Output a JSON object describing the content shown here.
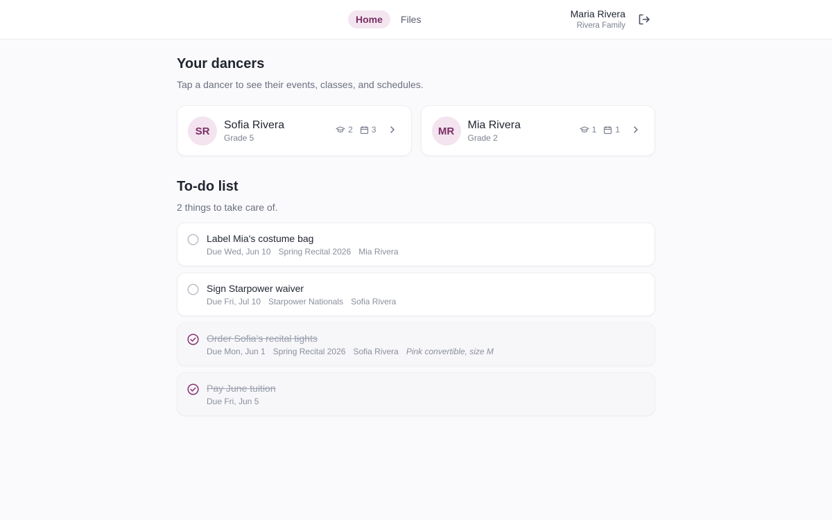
{
  "nav": {
    "items": [
      {
        "label": "Home",
        "active": true
      },
      {
        "label": "Files",
        "active": false
      }
    ]
  },
  "user": {
    "name": "Maria Rivera",
    "family": "Rivera Family",
    "logout_icon": "logout-icon"
  },
  "dancers_section": {
    "title": "Your dancers",
    "subtitle": "Tap a dancer to see their events, classes, and schedules.",
    "dancers": [
      {
        "initials": "SR",
        "name": "Sofia Rivera",
        "grade": "Grade 5",
        "classes": "2",
        "events": "3"
      },
      {
        "initials": "MR",
        "name": "Mia Rivera",
        "grade": "Grade 2",
        "classes": "1",
        "events": "1"
      }
    ]
  },
  "todo_section": {
    "title": "To-do list",
    "subtitle": "2 things to take care of.",
    "items": [
      {
        "label": "Label Mia's costume bag",
        "due": "Due Wed, Jun 10",
        "event": "Spring Recital 2026",
        "dancer": "Mia Rivera",
        "done": false
      },
      {
        "label": "Sign Starpower waiver",
        "due": "Due Fri, Jul 10",
        "event": "Starpower Nationals",
        "dancer": "Sofia Rivera",
        "done": false
      },
      {
        "label": "Order Sofia's recital tights",
        "due": "Due Mon, Jun 1",
        "event": "Spring Recital 2026",
        "dancer": "Sofia Rivera",
        "note": "Pink convertible, size M",
        "done": true
      },
      {
        "label": "Pay June tuition",
        "due": "Due Fri, Jun 5",
        "done": true
      }
    ]
  },
  "colors": {
    "accent": "#7a2e63",
    "accent_bg": "#f4e6f1",
    "page_bg": "#fafafc"
  }
}
